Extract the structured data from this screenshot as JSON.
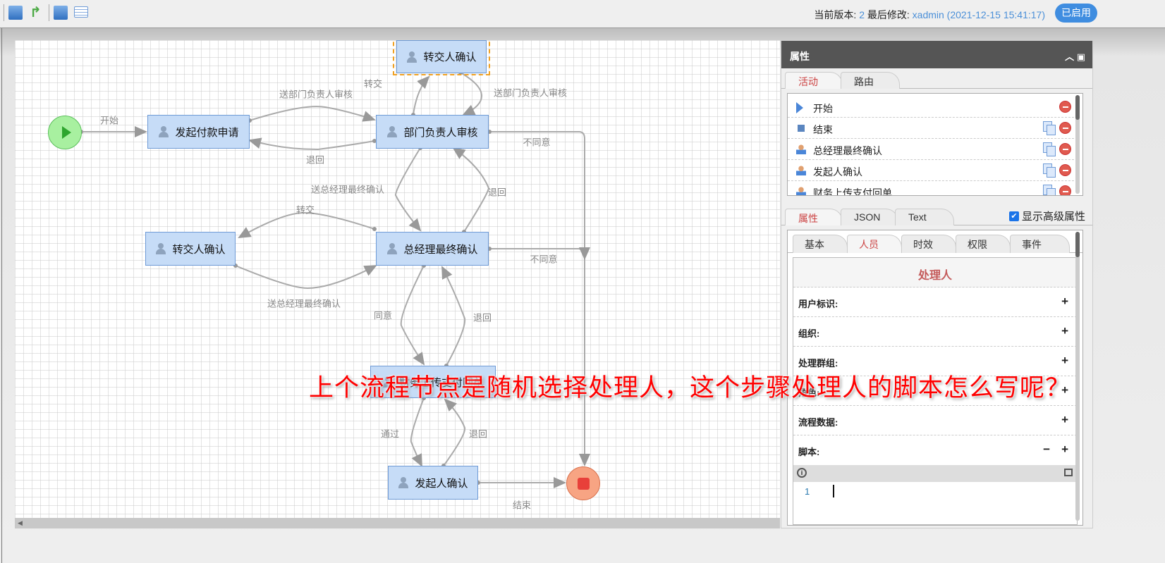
{
  "toolbar": {
    "icons": [
      "save-icon",
      "publish-branch-icon",
      "save-as-icon",
      "list-view-icon"
    ],
    "version_label": "当前版本:",
    "version_value": "2",
    "modified_label": "最后修改:",
    "modified_value": "xadmin (2021-12-15 15:41:17)",
    "status_button": "已启用"
  },
  "diagram": {
    "nodes": {
      "start": "开始",
      "apply": "发起付款申请",
      "transfer_top": "转交人确认",
      "dept_review": "部门负责人审核",
      "transfer_left": "转交人确认",
      "gm_confirm": "总经理最终确认",
      "hidden_node": "财务上传支付回单",
      "initiator_confirm": "发起人确认",
      "end": "结束"
    },
    "edges": {
      "e_start": "开始",
      "e_send_dept": "送部门负责人审核",
      "e_back1": "退回",
      "e_transfer1": "转交",
      "e_send_dept2": "送部门负责人审核",
      "e_disagree1": "不同意",
      "e_send_gm": "送总经理最终确认",
      "e_back2": "退回",
      "e_transfer2": "转交",
      "e_disagree2": "不同意",
      "e_send_gm2": "送总经理最终确认",
      "e_agree": "同意",
      "e_back3": "退回",
      "e_pass": "通过",
      "e_back4": "退回",
      "e_end": "结束"
    },
    "colors": {
      "node_fill": "#c6dcf7",
      "start": "#7ee07e",
      "end": "#f08a6a",
      "selection": "#f0a020"
    }
  },
  "panel": {
    "title": "属性",
    "top_tabs": [
      "活动",
      "路由"
    ],
    "activities": [
      {
        "label": "开始",
        "icon": "start-triangle-icon"
      },
      {
        "label": "结束",
        "icon": "end-square-icon"
      },
      {
        "label": "总经理最终确认",
        "icon": "user-icon"
      },
      {
        "label": "发起人确认",
        "icon": "user-icon"
      },
      {
        "label": "财务上传支付回单",
        "icon": "user-icon"
      }
    ],
    "prop_tabs": [
      "属性",
      "JSON",
      "Text"
    ],
    "show_advanced": "显示高级属性",
    "sub_tabs": [
      "基本",
      "人员",
      "时效",
      "权限",
      "事件"
    ],
    "handler_title": "处理人",
    "fields": [
      "用户标识:",
      "组织:",
      "处理群组:",
      "角色:",
      "流程数据:",
      "脚本:"
    ],
    "editor_line": "1"
  },
  "overlay_caption": "上个流程节点是随机选择处理人，这个步骤处理人的脚本怎么写呢？"
}
